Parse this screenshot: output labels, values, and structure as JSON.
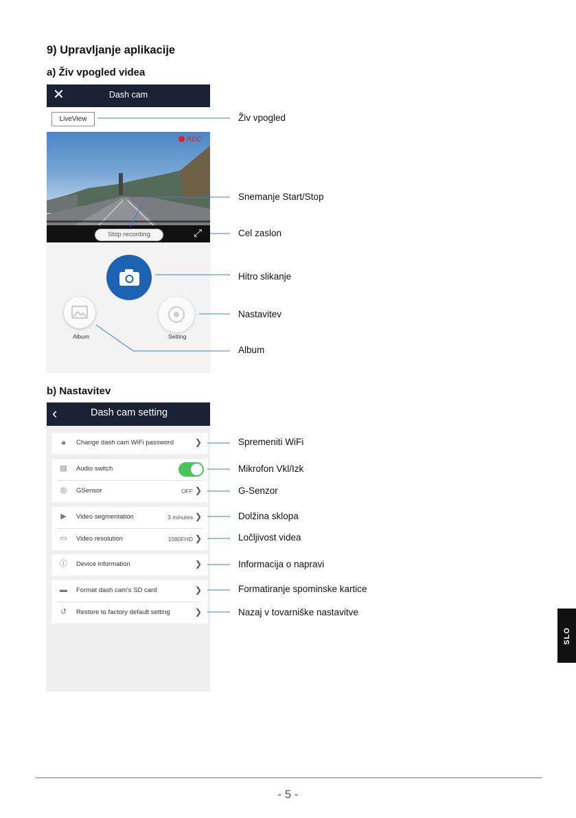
{
  "heading": "9) Upravljanje aplikacije",
  "section_a": "a) Živ vpogled videa",
  "section_b": "b) Nastavitev",
  "liveview_screen": {
    "title": "Dash cam",
    "liveview_label": "LiveView",
    "rec_label": "REC",
    "stop_label": "Stop recording",
    "album_label": "Album",
    "setting_label": "Setting"
  },
  "callouts_a": [
    "Živ vpogled",
    "Snemanje Start/Stop",
    "Cel zaslon",
    "Hitro slikanje",
    "Nastavitev",
    "Album"
  ],
  "settings_screen": {
    "title": "Dash cam setting",
    "wifi": "Change dash cam WiFi password",
    "audio": "Audio switch",
    "gsensor": "GSensor",
    "gsensor_value": "OFF",
    "segmentation": "Video segmentation",
    "segmentation_value": "3 minutes",
    "resolution": "Video resolution",
    "resolution_value": "1080FHD",
    "device_info": "Device information",
    "format": "Format dash cam's SD card",
    "restore": "Restore to factory default setting"
  },
  "callouts_b": [
    "Spremeniti WiFi",
    "Mikrofon Vkl/Izk",
    "G-Senzor",
    "Dolžina sklopa",
    "Ločljivost videa",
    "Informacija o napravi",
    "Formatiranje spominske kartice",
    "Nazaj v tovarniške nastavitve"
  ],
  "side_tab": "SLO",
  "page_number": "- 5 -",
  "colors": {
    "header": "#1a2335",
    "camera_button": "#1d63b4",
    "toggle_on": "#4bc35b",
    "rec": "#e02020",
    "leader": "#3a7fc4"
  },
  "toggles": {
    "audio_switch_on": true
  }
}
